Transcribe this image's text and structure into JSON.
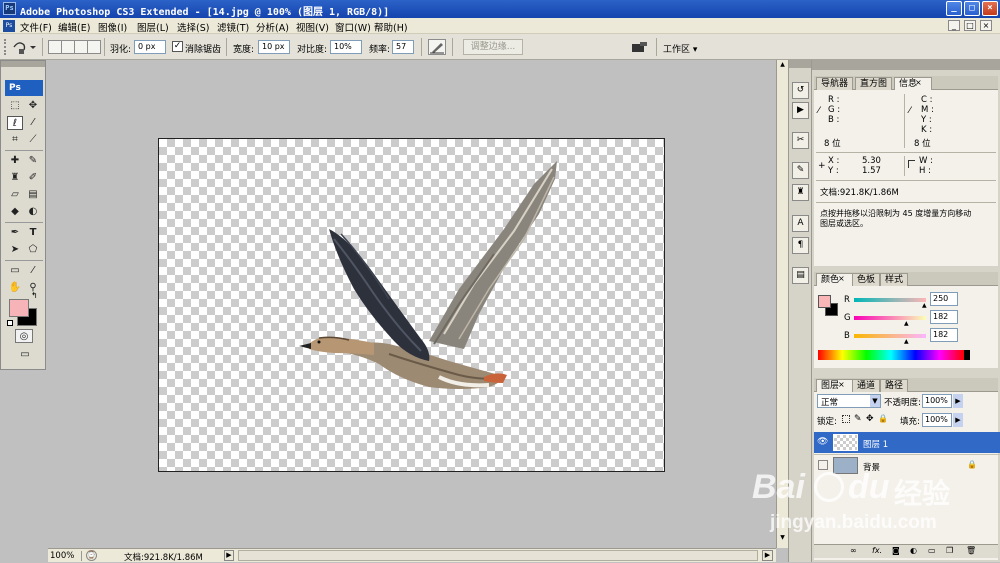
{
  "titlebar": {
    "logo": "Ps",
    "title": "Adobe Photoshop CS3 Extended - [14.jpg @ 100% (图层 1, RGB/8)]",
    "buttons": [
      "_",
      "□",
      "×"
    ]
  },
  "menubar": {
    "items": [
      "文件(F)",
      "编辑(E)",
      "图像(I)",
      "图层(L)",
      "选择(S)",
      "滤镜(T)",
      "分析(A)",
      "视图(V)",
      "窗口(W)",
      "帮助(H)"
    ],
    "doc_buttons": [
      "_",
      "□",
      "×"
    ]
  },
  "options": {
    "feather_label": "羽化:",
    "feather_value": "0 px",
    "antialias_label": "消除锯齿",
    "antialias_checked": true,
    "width_label": "宽度:",
    "width_value": "10 px",
    "contrast_label": "对比度:",
    "contrast_value": "10%",
    "frequency_label": "频率:",
    "frequency_value": "57",
    "refine_edge_label": "调整边缘...",
    "workspace_label": "工作区 ▾"
  },
  "toolbox": {
    "logo": "Ps",
    "foreground_color": "#f7b4b8",
    "background_color": "#000000"
  },
  "status": {
    "zoom": "100%",
    "doc_info": "文档:921.8K/1.86M"
  },
  "info_panel": {
    "tabs": [
      "导航器",
      "直方图",
      "信息"
    ],
    "active_tab": "信息",
    "rgb_labels": [
      "R :",
      "G :",
      "B :"
    ],
    "cmyk_labels": [
      "C :",
      "M :",
      "Y :",
      "K :"
    ],
    "bit_depth_left": "8 位",
    "bit_depth_right": "8 位",
    "x_label": "X :",
    "x_value": "5.30",
    "y_label": "Y :",
    "y_value": "1.57",
    "w_label": "W :",
    "h_label": "H :",
    "doc_info": "文档:921.8K/1.86M",
    "hint_line1": "点按并拖移以沿限制为 45 度增量方向移动",
    "hint_line2": "图层或选区。"
  },
  "color_panel": {
    "tabs": [
      "颜色",
      "色板",
      "样式"
    ],
    "active_tab": "颜色",
    "channels": [
      {
        "label": "R",
        "value": "250"
      },
      {
        "label": "G",
        "value": "182"
      },
      {
        "label": "B",
        "value": "182"
      }
    ],
    "foreground": "#fab6b6"
  },
  "layers_panel": {
    "tabs": [
      "图层",
      "通道",
      "路径"
    ],
    "active_tab": "图层",
    "blend_mode": "正常",
    "opacity_label": "不透明度:",
    "opacity_value": "100%",
    "lock_label": "锁定:",
    "fill_label": "填充:",
    "fill_value": "100%",
    "layers": [
      {
        "name": "图层 1",
        "visible": true,
        "selected": true
      },
      {
        "name": "背景",
        "visible": false,
        "selected": false
      }
    ],
    "footer_icons": [
      "link-icon",
      "fx-icon",
      "mask-icon",
      "adjustment-icon",
      "group-icon",
      "new-layer-icon",
      "trash-icon"
    ]
  },
  "watermark": {
    "brand": "Bai",
    "brand2": "du",
    "cn": "经验",
    "url": "jingyan.baidu.com"
  }
}
